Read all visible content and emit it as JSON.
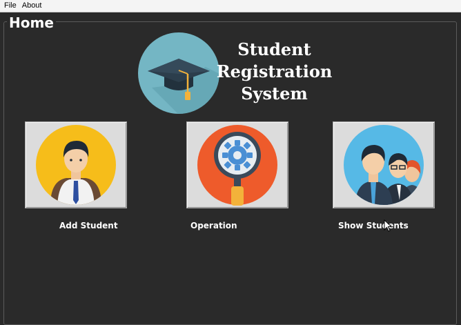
{
  "menu": {
    "file_label": "File",
    "about_label": "About"
  },
  "window": {
    "title": "Home"
  },
  "logo": {
    "title_line1": "Student",
    "title_line2": "Registration",
    "title_line3": "System"
  },
  "tiles": [
    {
      "label": "Add Student",
      "icon": "student-icon"
    },
    {
      "label": "Operation",
      "icon": "gear-magnifier-icon"
    },
    {
      "label": "Show Students",
      "icon": "students-group-icon"
    }
  ],
  "colors": {
    "background": "#2a2a2a",
    "logo_circle": "#74b6c4",
    "student_circle": "#f6bd1a",
    "operation_circle": "#ee5b2b",
    "students_circle": "#56b9e6"
  }
}
